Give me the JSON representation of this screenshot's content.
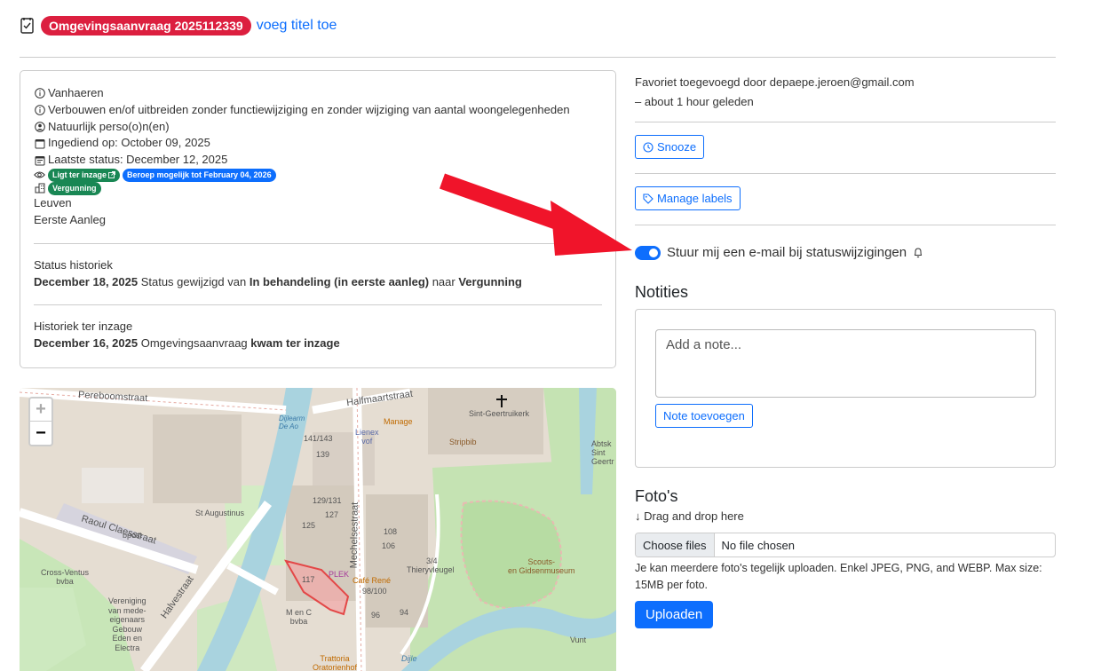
{
  "header": {
    "badge": "Omgevingsaanvraag 2025112339",
    "add_title_link": "voeg titel toe"
  },
  "info": {
    "applicant": "Vanhaeren",
    "description": "Verbouwen en/of uitbreiden zonder functiewijziging en zonder wijziging van aantal woongelegenheden",
    "person_type": "Natuurlijk perso(o)n(en)",
    "submitted": "Ingediend op: October 09, 2025",
    "last_status": "Laatste status: December 12, 2025",
    "pill_inzage": "Ligt ter inzage",
    "pill_beroep": "Beroep mogelijk tot February 04, 2026",
    "pill_vergunning": "Vergunning",
    "city": "Leuven",
    "procedure": "Eerste Aanleg"
  },
  "status_history": {
    "label": "Status historiek",
    "date": "December 18, 2025",
    "text1": " Status gewijzigd van ",
    "from": "In behandeling (in eerste aanleg)",
    "text2": " naar ",
    "to": "Vergunning"
  },
  "inzage_history": {
    "label": "Historiek ter inzage",
    "date": "December 16, 2025",
    "text1": " Omgevingsaanvraag ",
    "bold": "kwam ter inzage"
  },
  "map": {
    "zoom_in": "+",
    "zoom_out": "−",
    "labels": {
      "pereboomstraat": "Pereboomstraat",
      "halfmaartstraat": "Halfmaartstraat",
      "sint_geertruikerk": "Sint-Geertruikerk",
      "stripbib": "Stripbib",
      "manage": "Manage",
      "st_augustinus": "St Augustinus",
      "bpost": "bpost",
      "raoul_claesstraat": "Raoul Claesstraat",
      "mechelsestraat": "Mechelsestraat",
      "halvestraat": "Halvestraat",
      "cross_ventus": "Cross-Ventus\nbvba",
      "vereniging": "Vereniging\nvan mede-\neigenaars\nGebouw\nEden en\nElectra",
      "plek": "PLEK",
      "cafe_rene": "Café René",
      "m_en_c": "M en C\nbvba",
      "trattoria": "Trattoria\nOratorienhof",
      "thieryvleugel": "Thieryvleugel",
      "scouts": "Scouts-\nen Gidsenmuseum",
      "lienex": "Lienex\nvof",
      "dijle": "Dijle",
      "abtsk": "Abtsk\nSint\nGeertr",
      "n141": "141/143",
      "n139": "139",
      "n129": "129/131",
      "n127": "127",
      "n125": "125",
      "n117": "117",
      "n108": "108",
      "n106": "106",
      "n98": "98/100",
      "n96": "96",
      "n94": "94",
      "n34": "3/4",
      "dijlearm": "Dijlearm\nDe Ao",
      "vunt": "Vunt"
    }
  },
  "right": {
    "favorite_line1": "Favoriet toegevoegd door depaepe.jeroen@gmail.com",
    "favorite_line2": "– about 1 hour geleden",
    "snooze": "Snooze",
    "manage_labels": "Manage labels",
    "email_toggle": "Stuur mij een e-mail bij statuswijzigingen",
    "notities_title": "Notities",
    "note_placeholder": "Add a note...",
    "note_button": "Note toevoegen",
    "fotos_title": "Foto's",
    "drag_drop": "↓ Drag and drop here",
    "choose_files": "Choose files",
    "no_file": "No file chosen",
    "help": "Je kan meerdere foto's tegelijk uploaden. Enkel JPEG, PNG, and WEBP. Max size: 15MB per foto.",
    "upload": "Uploaden"
  }
}
